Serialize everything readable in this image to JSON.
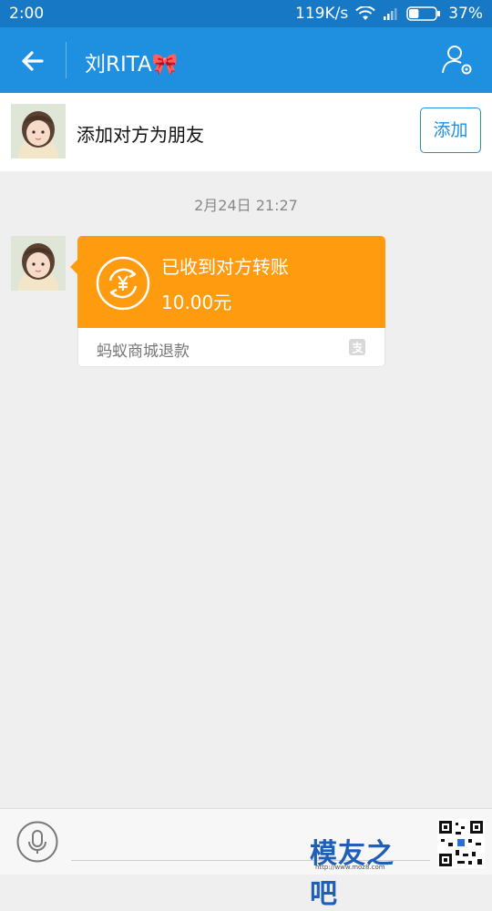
{
  "status_bar": {
    "time": "2:00",
    "net_speed": "119K/s",
    "battery": "37%",
    "battery_level": 0.37,
    "icons": [
      "wifi-icon",
      "signal-icon",
      "battery-icon"
    ]
  },
  "header": {
    "title": "刘RITA🎀",
    "back_icon": "arrow-left-icon",
    "profile_icon": "user-settings-icon",
    "color": "#1f8fe0"
  },
  "add_friend": {
    "text": "添加对方为朋友",
    "button_label": "添加"
  },
  "chat": {
    "timestamp": "2月24日 21:27",
    "messages": [
      {
        "type": "transfer",
        "title": "已收到对方转账",
        "amount": "10.00元",
        "source": "蚂蚁商城退款",
        "icon": "transfer-coin-icon",
        "color": "#ff9b0f"
      }
    ]
  },
  "input": {
    "placeholder": "",
    "mic_icon": "microphone-icon"
  },
  "watermark": {
    "text": "模友之吧",
    "url": "http://www.moz8.com"
  }
}
